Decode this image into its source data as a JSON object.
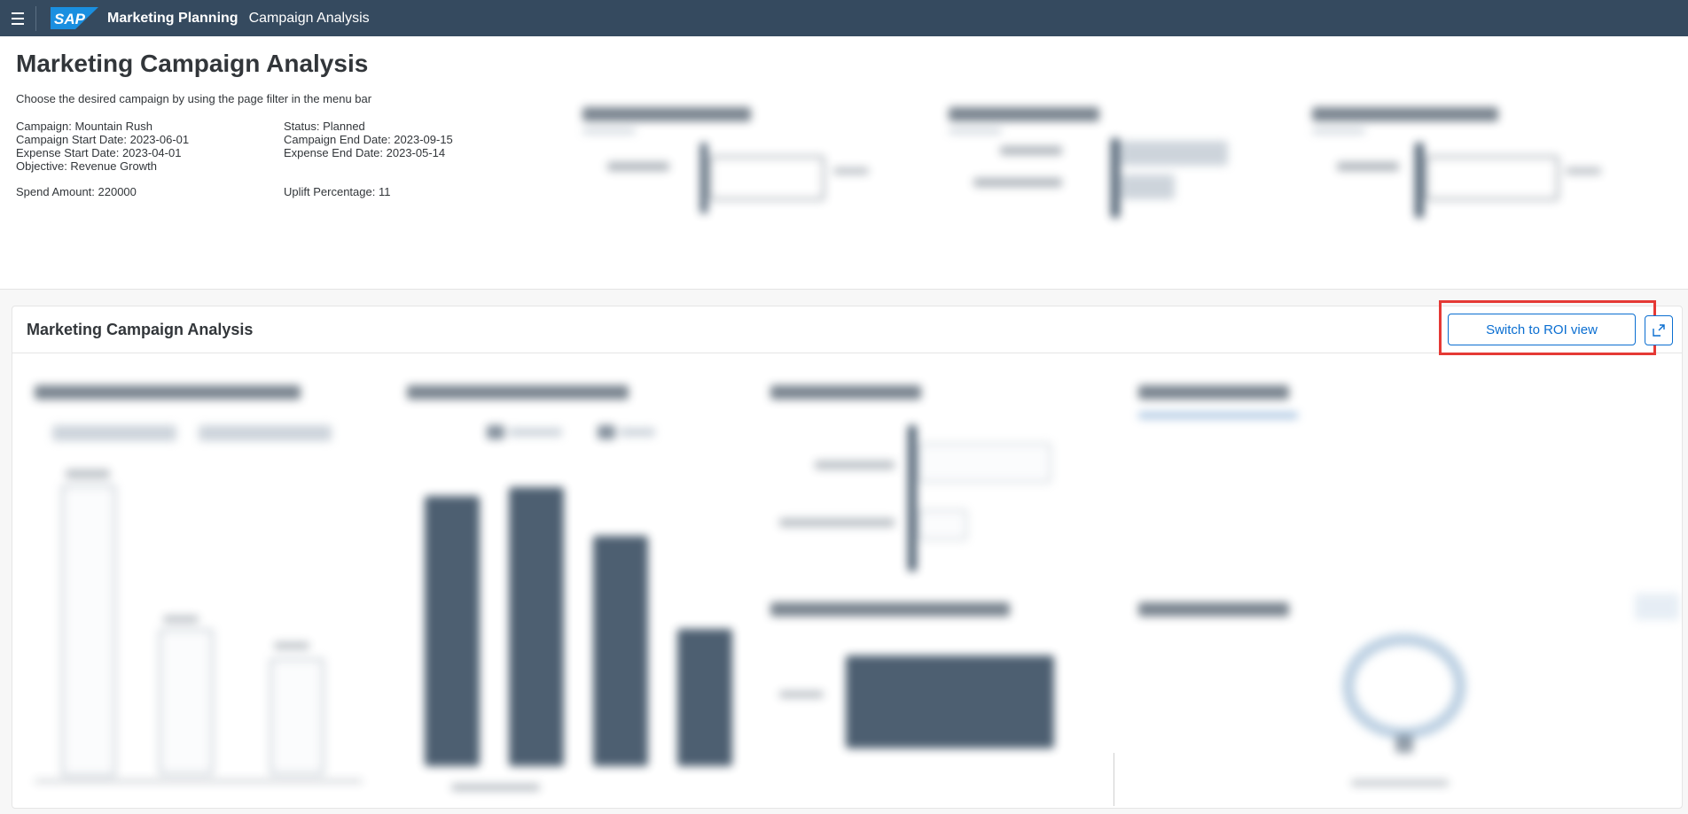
{
  "shell": {
    "app_title": "Marketing Planning",
    "app_subtitle": "Campaign Analysis",
    "logo_text": "SAP"
  },
  "header": {
    "title": "Marketing Campaign Analysis",
    "instruction": "Choose the desired campaign by using the page filter in the menu bar",
    "left_info": [
      "Campaign: Mountain Rush",
      "Campaign Start Date: 2023-06-01",
      "Expense Start Date: 2023-04-01",
      "Objective: Revenue Growth"
    ],
    "right_info": [
      "Status: Planned",
      "Campaign End Date: 2023-09-15",
      "Expense End Date: 2023-05-14"
    ],
    "spend": "Spend Amount: 220000",
    "uplift": "Uplift Percentage: 11"
  },
  "card": {
    "title": "Marketing Campaign Analysis",
    "roi_button_label": "Switch to ROI view",
    "expand_icon": "expand-icon"
  },
  "colors": {
    "shell_bg": "#354a5f",
    "accent": "#0a6ed1",
    "highlight": "#e53935",
    "bar_dark": "#3a4e62"
  }
}
